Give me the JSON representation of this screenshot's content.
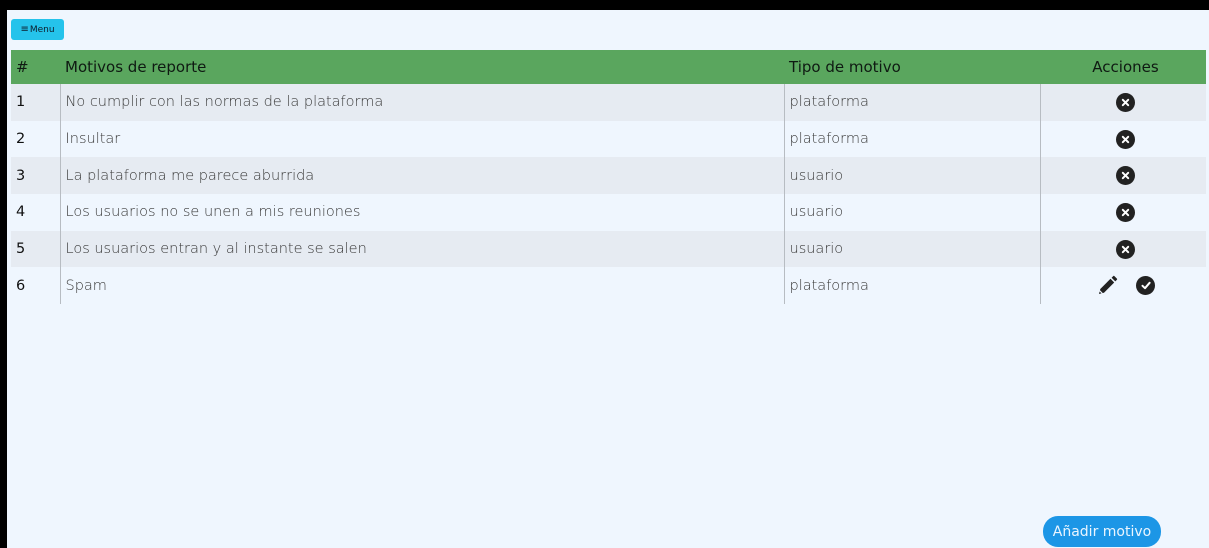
{
  "menu": {
    "label": "Menu",
    "icon": "hamburger-icon"
  },
  "table": {
    "headers": {
      "num": "#",
      "reason": "Motivos de reporte",
      "type": "Tipo de motivo",
      "actions": "Acciones"
    },
    "rows": [
      {
        "num": "1",
        "reason": "No cumplir con las normas de la plataforma",
        "type": "plataforma",
        "actions": [
          "delete-icon"
        ]
      },
      {
        "num": "2",
        "reason": "Insultar",
        "type": "plataforma",
        "actions": [
          "delete-icon"
        ]
      },
      {
        "num": "3",
        "reason": "La plataforma me parece aburrida",
        "type": "usuario",
        "actions": [
          "delete-icon"
        ]
      },
      {
        "num": "4",
        "reason": "Los usuarios no se unen a mis reuniones",
        "type": "usuario",
        "actions": [
          "delete-icon"
        ]
      },
      {
        "num": "5",
        "reason": "Los usuarios entran y al instante se salen",
        "type": "usuario",
        "actions": [
          "delete-icon"
        ]
      },
      {
        "num": "6",
        "reason": "Spam",
        "type": "plataforma",
        "actions": [
          "pencil-icon",
          "check-icon"
        ]
      }
    ]
  },
  "add_button": {
    "label": "Añadir motivo"
  },
  "colors": {
    "header_bg": "#5aa65e",
    "menu_bg": "#25c3eb",
    "add_bg": "#1c96e6",
    "page_bg": "#eff6fe"
  }
}
